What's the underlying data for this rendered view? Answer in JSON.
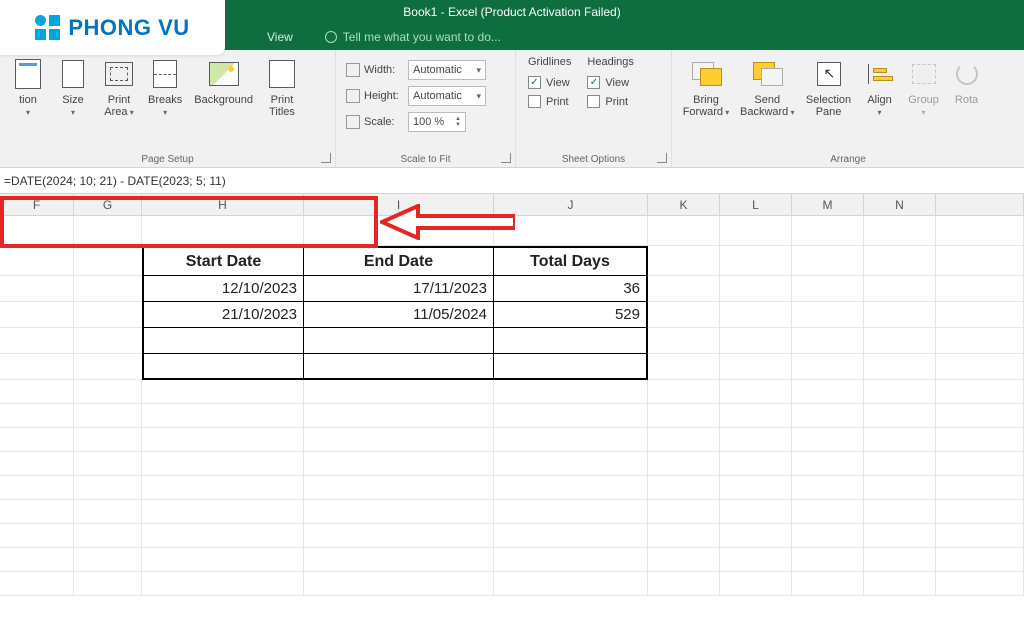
{
  "logo": {
    "text": "PHONG VU"
  },
  "window": {
    "title": "Book1 - Excel (Product Activation Failed)"
  },
  "tabs": {
    "view": "View",
    "tellme": "Tell me what you want to do..."
  },
  "ribbon": {
    "page_setup": {
      "orientation_partial": "tion",
      "size": "Size",
      "print_area": "Print\nArea",
      "breaks": "Breaks",
      "background": "Background",
      "print_titles": "Print\nTitles",
      "group_label": "Page Setup"
    },
    "scale": {
      "width_lbl": "Width:",
      "width_val": "Automatic",
      "height_lbl": "Height:",
      "height_val": "Automatic",
      "scale_lbl": "Scale:",
      "scale_val": "100 %",
      "group_label": "Scale to Fit"
    },
    "sheet": {
      "gridlines": "Gridlines",
      "headings": "Headings",
      "view": "View",
      "print": "Print",
      "group_label": "Sheet Options"
    },
    "arrange": {
      "bring_forward": "Bring\nForward",
      "send_backward": "Send\nBackward",
      "selection_pane": "Selection\nPane",
      "align": "Align",
      "group": "Group",
      "rotate": "Rota",
      "group_label": "Arrange"
    }
  },
  "formula": "=DATE(2024; 10; 21) - DATE(2023; 5; 11)",
  "columns": [
    "F",
    "G",
    "H",
    "I",
    "J",
    "K",
    "L",
    "M",
    "N"
  ],
  "table": {
    "headers": {
      "start": "Start Date",
      "end": "End Date",
      "total": "Total Days"
    },
    "rows": [
      {
        "start": "12/10/2023",
        "end": "17/11/2023",
        "total": "36"
      },
      {
        "start": "21/10/2023",
        "end": "11/05/2024",
        "total": "529"
      }
    ]
  }
}
